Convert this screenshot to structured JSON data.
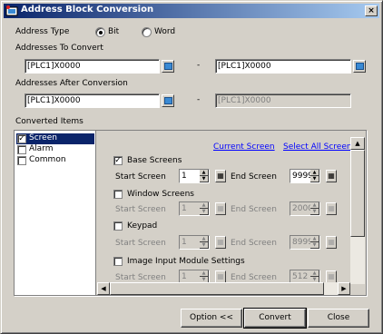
{
  "window": {
    "title": "Address Block Conversion",
    "close_glyph": "×"
  },
  "address_type": {
    "label": "Address Type",
    "options": [
      {
        "label": "Bit",
        "checked": true
      },
      {
        "label": "Word",
        "checked": false
      }
    ]
  },
  "addresses_to_convert": {
    "label": "Addresses To Convert",
    "from": "[PLC1]X0000",
    "separator": "-",
    "to": "[PLC1]X0000"
  },
  "addresses_after_conversion": {
    "label": "Addresses After Conversion",
    "from": "[PLC1]X0000",
    "separator": "-",
    "to": "[PLC1]X0000"
  },
  "converted_items": {
    "label": "Converted Items",
    "list": [
      {
        "label": "Screen",
        "checked": true,
        "selected": true
      },
      {
        "label": "Alarm",
        "checked": false,
        "selected": false
      },
      {
        "label": "Common",
        "checked": false,
        "selected": false
      }
    ]
  },
  "screen_panel": {
    "current_screen_link": "Current Screen",
    "select_all_link": "Select All Screens",
    "start_label": "Start Screen",
    "end_label": "End Screen",
    "groups": [
      {
        "label": "Base Screens",
        "checked": true,
        "enabled": true,
        "start": "1",
        "end": "9999"
      },
      {
        "label": "Window Screens",
        "checked": false,
        "enabled": false,
        "start": "1",
        "end": "2000"
      },
      {
        "label": "Keypad",
        "checked": false,
        "enabled": false,
        "start": "1",
        "end": "8999"
      },
      {
        "label": "Image Input Module Settings",
        "checked": false,
        "enabled": false,
        "start": "1",
        "end": "512"
      }
    ]
  },
  "buttons": {
    "option": "Option <<",
    "convert": "Convert",
    "close": "Close"
  },
  "colors": {
    "title_bar": "#0a246a",
    "selection": "#0a246a",
    "link": "#0000ff",
    "face": "#d4d0c8"
  },
  "icons": {
    "app": "app-icon",
    "picker": "address-picker-icon",
    "keypad": "keypad-icon"
  }
}
